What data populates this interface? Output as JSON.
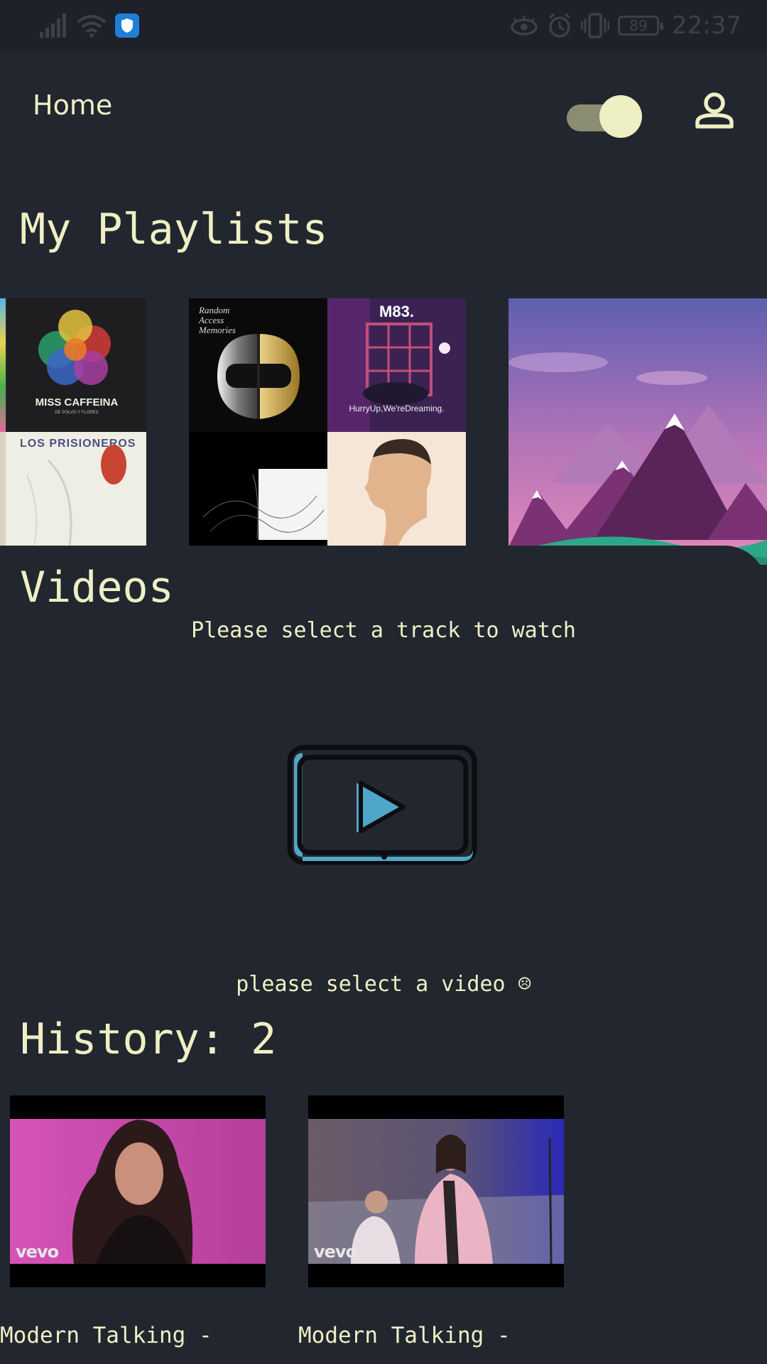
{
  "status_bar": {
    "time": "22:37",
    "battery": "89",
    "icons": [
      "signal-icon",
      "wifi-icon",
      "shield-app-icon",
      "eye-icon",
      "alarm-icon",
      "vibrate-icon",
      "battery-icon"
    ]
  },
  "app_bar": {
    "title": "Home",
    "theme_toggle_on": true,
    "profile_icon": "person-icon"
  },
  "playlists": {
    "heading": "My Playlists",
    "items": [
      {
        "covers": [
          "MISS CAFFEINA",
          "LOS PRISIONEROS"
        ]
      },
      {
        "covers": [
          "Random Access Memories",
          "M83.",
          "HurryUp,We'reDreaming."
        ]
      },
      {
        "covers": [
          "mountain-landscape"
        ]
      }
    ],
    "cover_texts": {
      "miss_caffeina": "MISS CAFFEINA",
      "miss_caffeina_sub": "DE POLVO Y FLORES",
      "los_prisioneros": "LOS PRISIONEROS",
      "daft_punk_script": "Random Access Memories",
      "m83": "M83.",
      "m83_sub": "HurryUp,We'reDreaming."
    }
  },
  "videos": {
    "heading": "Videos",
    "hint": "Please select a track to watch",
    "empty_message": "please select a video ☹"
  },
  "history": {
    "heading": "History: 2",
    "items": [
      {
        "title": "Modern Talking -",
        "badge": "vevo"
      },
      {
        "title": "Modern Talking -",
        "badge": "vevo"
      }
    ]
  },
  "colors": {
    "background": "#22262f",
    "text": "#eef0c4",
    "accent": "#4fa6c8",
    "status_bar": "#1e2129"
  }
}
